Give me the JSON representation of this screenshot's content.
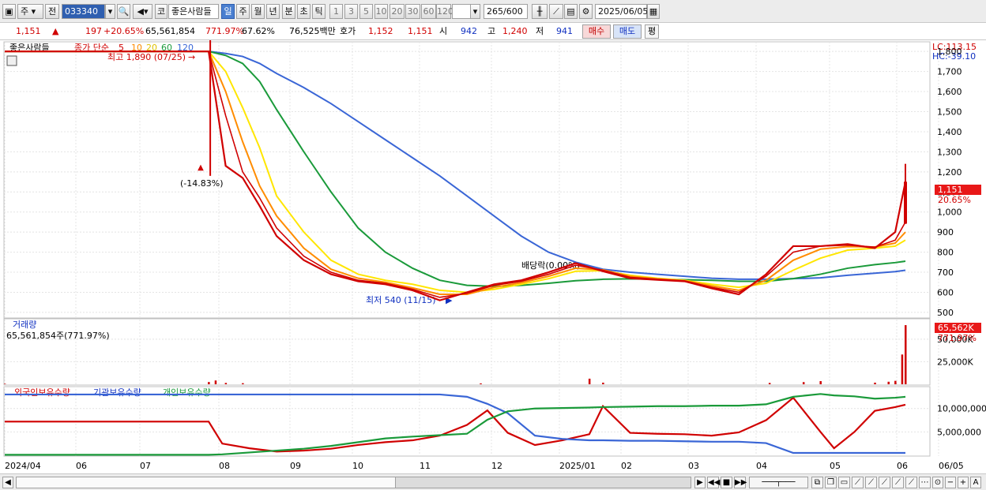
{
  "toolbar": {
    "market": "주",
    "view": "전",
    "code": "033340",
    "name_btn": "코",
    "stock_name": "좋은사람들",
    "periods": [
      "일",
      "주",
      "월",
      "년",
      "분",
      "초",
      "틱"
    ],
    "active_period": "일",
    "intervals": [
      "1",
      "3",
      "5",
      "10",
      "20",
      "30",
      "60",
      "120"
    ],
    "count": "265",
    "count_total": "/600",
    "date": "2025/06/05"
  },
  "quote": {
    "price": "1,151",
    "change": "197",
    "change_pct": "+20.65%",
    "volume": "65,561,854",
    "volume_pct": "771.97%",
    "ratio": "67.62%",
    "amount": "76,525백만",
    "bid_label": "호가",
    "bid": "1,152",
    "ask": "1,151",
    "open_label": "시",
    "open": "942",
    "high_label": "고",
    "high": "1,240",
    "low_label": "저",
    "low": "941",
    "buy": "매수",
    "sell": "매도",
    "avg": "평"
  },
  "colors": {
    "up": "#d00000",
    "down": "#1030c0",
    "ma5": "#d00000",
    "ma10": "#ff8c00",
    "ma20": "#ffe600",
    "ma60": "#1a9a3a",
    "ma120": "#3a66d6"
  },
  "chart_data": [
    {
      "type": "line",
      "name": "price",
      "title_name": "좋은사람들",
      "legend": [
        "종가 단순",
        "5",
        "10",
        "20",
        "60",
        "120"
      ],
      "ylim": [
        480,
        1840
      ],
      "yticks": [
        "1,800",
        "1,700",
        "1,600",
        "1,500",
        "1,400",
        "1,300",
        "1,200",
        "1,100",
        "1,000",
        "900",
        "800",
        "700",
        "600",
        "500"
      ],
      "lc": "LC:113.15",
      "hc": "HC:-39.10",
      "last_price_label": "1,151",
      "last_change_label": "20.65%",
      "annotations": {
        "high": "최고 1,890 (07/25)",
        "low": "최저 540 (11/15)",
        "drop": "(-14.83%)",
        "dividend": "배당락(0.00%)"
      },
      "xlabels": [
        "2024/04",
        "06",
        "07",
        "08",
        "09",
        "10",
        "11",
        "12",
        "2025/01",
        "02",
        "03",
        "04",
        "05",
        "06",
        "06/05"
      ],
      "x": [
        0,
        24,
        48,
        60,
        65,
        70,
        75,
        80,
        88,
        96,
        104,
        112,
        120,
        128,
        136,
        144,
        152,
        160,
        168,
        176,
        184,
        192,
        200,
        208,
        216,
        224,
        232,
        240,
        248,
        256,
        262,
        265
      ],
      "series": [
        {
          "name": "종가",
          "values": [
            1800,
            1800,
            1800,
            1800,
            1230,
            1170,
            1030,
            880,
            760,
            690,
            655,
            640,
            610,
            560,
            600,
            640,
            660,
            700,
            745,
            705,
            670,
            662,
            655,
            620,
            590,
            690,
            830,
            830,
            840,
            820,
            900,
            1151
          ]
        },
        {
          "name": "5",
          "values": [
            1800,
            1800,
            1800,
            1800,
            1480,
            1200,
            1070,
            920,
            780,
            700,
            660,
            645,
            615,
            575,
            595,
            635,
            655,
            690,
            735,
            710,
            675,
            665,
            657,
            625,
            600,
            680,
            800,
            830,
            835,
            825,
            860,
            950
          ]
        },
        {
          "name": "10",
          "values": [
            1800,
            1800,
            1800,
            1800,
            1600,
            1350,
            1130,
            980,
            820,
            715,
            670,
            650,
            622,
            590,
            590,
            625,
            648,
            680,
            720,
            712,
            680,
            667,
            658,
            632,
            610,
            660,
            760,
            815,
            828,
            826,
            845,
            900
          ]
        },
        {
          "name": "20",
          "values": [
            1800,
            1800,
            1800,
            1800,
            1700,
            1520,
            1320,
            1080,
            900,
            760,
            690,
            660,
            640,
            610,
            600,
            615,
            640,
            668,
            705,
            708,
            685,
            670,
            660,
            640,
            625,
            645,
            710,
            770,
            810,
            820,
            830,
            860
          ]
        },
        {
          "name": "60",
          "values": [
            1800,
            1800,
            1800,
            1800,
            1780,
            1740,
            1650,
            1510,
            1300,
            1100,
            920,
            800,
            720,
            660,
            635,
            630,
            635,
            645,
            658,
            665,
            667,
            665,
            663,
            660,
            655,
            655,
            668,
            690,
            720,
            738,
            748,
            755
          ]
        },
        {
          "name": "120",
          "values": [
            1800,
            1800,
            1800,
            1800,
            1790,
            1775,
            1740,
            1690,
            1620,
            1540,
            1450,
            1360,
            1270,
            1180,
            1080,
            980,
            880,
            800,
            750,
            715,
            700,
            690,
            680,
            670,
            665,
            665,
            668,
            672,
            685,
            695,
            703,
            710
          ]
        }
      ]
    },
    {
      "type": "bar",
      "name": "volume",
      "title": "거래량",
      "value_label": "65,561,854주(771.97%)",
      "last_label": "65,562K",
      "last_pct_label": "771.97%",
      "ylim": [
        0,
        70000
      ],
      "yticks": [
        "25,000K",
        "50,000K"
      ],
      "x": [
        0,
        60,
        62,
        65,
        70,
        140,
        172,
        176,
        225,
        235,
        240,
        256,
        260,
        262,
        264,
        265
      ],
      "values": [
        500,
        2500,
        4200,
        1500,
        1200,
        1000,
        6200,
        1800,
        1500,
        2400,
        3500,
        1800,
        2800,
        3800,
        33000,
        65562
      ]
    },
    {
      "type": "line",
      "name": "ownership",
      "legend": [
        "외국인보유수량",
        "기관보유수량",
        "개인보유수량"
      ],
      "ylim": [
        0,
        14000000
      ],
      "yticks": [
        "10,000,000",
        "5,000,000"
      ],
      "x": [
        0,
        60,
        64,
        72,
        80,
        88,
        96,
        104,
        112,
        120,
        128,
        136,
        142,
        148,
        156,
        164,
        172,
        176,
        184,
        192,
        200,
        208,
        216,
        224,
        232,
        240,
        244,
        250,
        256,
        262,
        265
      ],
      "series": [
        {
          "name": "외국인보유수량",
          "values": [
            7200000,
            7200000,
            2500000,
            1500000,
            800000,
            1000000,
            1400000,
            2200000,
            2800000,
            3200000,
            4200000,
            6500000,
            9600000,
            4800000,
            2200000,
            3200000,
            4500000,
            10500000,
            4800000,
            4600000,
            4500000,
            4200000,
            4900000,
            7500000,
            12300000,
            5000000,
            1500000,
            5000000,
            9500000,
            10300000,
            10800000
          ]
        },
        {
          "name": "기관보유수량",
          "values": [
            13000000,
            13000000,
            13000000,
            13000000,
            13000000,
            13000000,
            13000000,
            13000000,
            13000000,
            13000000,
            13000000,
            12500000,
            11000000,
            9000000,
            4200000,
            3500000,
            3200000,
            3200000,
            3100000,
            3100000,
            3000000,
            2900000,
            2900000,
            2600000,
            500000,
            500000,
            500000,
            500000,
            500000,
            500000,
            500000
          ]
        },
        {
          "name": "개인보유수량",
          "values": [
            100000,
            100000,
            200000,
            600000,
            1000000,
            1400000,
            2000000,
            2800000,
            3600000,
            4000000,
            4300000,
            4600000,
            7600000,
            9400000,
            10000000,
            10100000,
            10200000,
            10300000,
            10400000,
            10500000,
            10500000,
            10600000,
            10600000,
            10900000,
            12500000,
            13100000,
            12800000,
            12600000,
            12100000,
            12300000,
            12500000
          ]
        }
      ]
    }
  ],
  "bottom": {
    "zoom_out": "−",
    "zoom_in": "+",
    "text": "A"
  }
}
